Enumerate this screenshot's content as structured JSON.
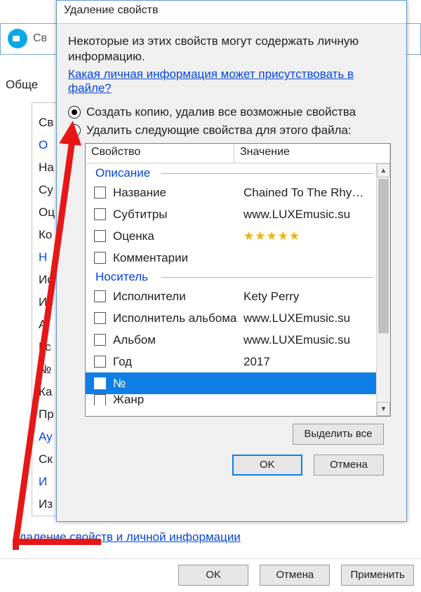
{
  "background": {
    "title": "Св",
    "tab": "Обще",
    "link": "Удаление свойств и личной информации",
    "buttons": {
      "ok": "OK",
      "cancel": "Отмена",
      "apply": "Применить"
    },
    "leftcol": [
      {
        "t": "Св",
        "g": false
      },
      {
        "t": "О",
        "g": true
      },
      {
        "t": "На",
        "g": false
      },
      {
        "t": "Су",
        "g": false
      },
      {
        "t": "Оц",
        "g": false
      },
      {
        "t": "Ко",
        "g": false
      },
      {
        "t": "Н",
        "g": true
      },
      {
        "t": "Ис",
        "g": false
      },
      {
        "t": "Ис",
        "g": false
      },
      {
        "t": "А",
        "g": false
      },
      {
        "t": "Гс",
        "g": false
      },
      {
        "t": "№",
        "g": false
      },
      {
        "t": "Ка",
        "g": false
      },
      {
        "t": "Пр",
        "g": false
      },
      {
        "t": "Ау",
        "g": true
      },
      {
        "t": "Ск",
        "g": false
      },
      {
        "t": "И",
        "g": true
      },
      {
        "t": "Из",
        "g": false
      }
    ]
  },
  "dialog": {
    "title": "Удаление свойств",
    "text1": "Некоторые из этих свойств могут содержать личную информацию.",
    "link": "Какая личная информация может присутствовать в файле?",
    "radio1": "Создать копию, удалив все возможные свойства",
    "radio2": "Удалить следующие свойства для этого файла:",
    "head_prop": "Свойство",
    "head_val": "Значение",
    "groups": [
      {
        "name": "Описание",
        "rows": [
          {
            "prop": "Название",
            "val": "Chained To The Rhy…",
            "type": "text"
          },
          {
            "prop": "Субтитры",
            "val": "www.LUXEmusic.su",
            "type": "text"
          },
          {
            "prop": "Оценка",
            "val": "★★★★★",
            "type": "stars"
          },
          {
            "prop": "Комментарии",
            "val": "",
            "type": "text"
          }
        ]
      },
      {
        "name": "Носитель",
        "rows": [
          {
            "prop": "Исполнители",
            "val": "Kety Perry",
            "type": "text"
          },
          {
            "prop": "Исполнитель альбома",
            "val": "www.LUXEmusic.su",
            "type": "text"
          },
          {
            "prop": "Альбом",
            "val": "www.LUXEmusic.su",
            "type": "text"
          },
          {
            "prop": "Год",
            "val": "2017",
            "type": "text"
          },
          {
            "prop": "№",
            "val": "",
            "type": "text",
            "selected": true
          },
          {
            "prop": "Жанр",
            "val": "",
            "type": "text",
            "cut": true
          }
        ]
      }
    ],
    "select_all": "Выделить все",
    "ok": "OK",
    "cancel": "Отмена"
  }
}
